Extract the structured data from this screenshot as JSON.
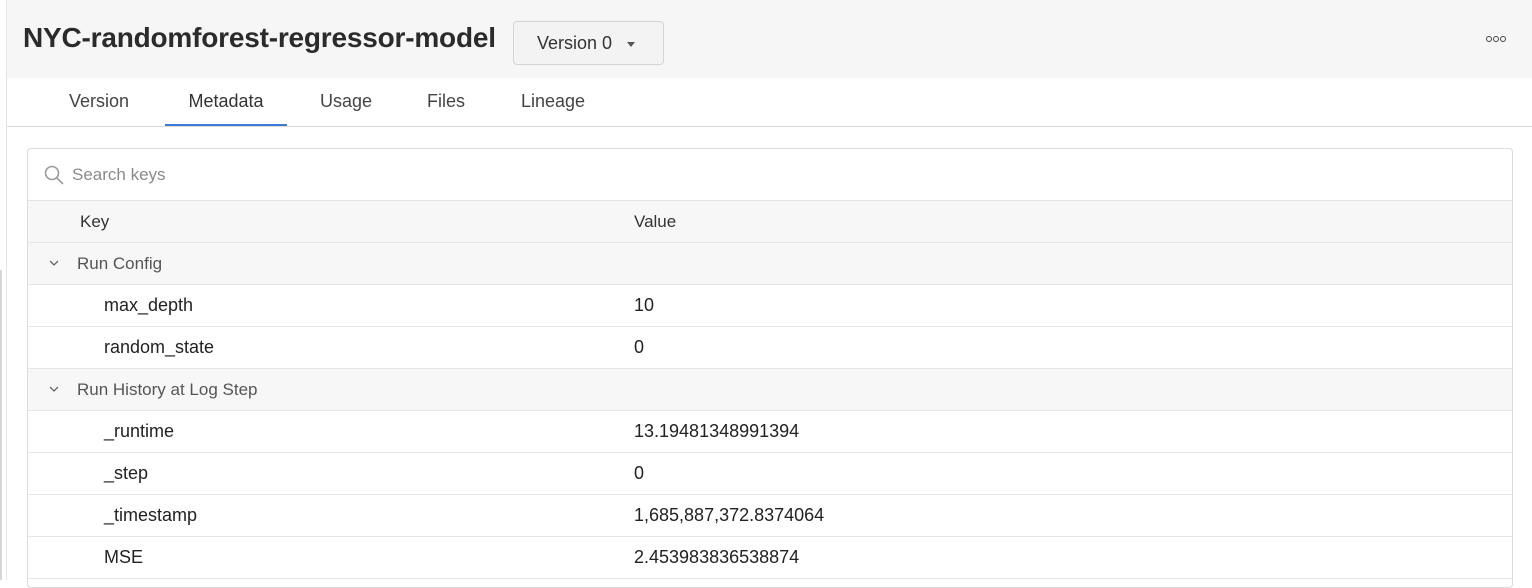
{
  "header": {
    "title": "NYC-randomforest-regressor-model",
    "version_label": "Version 0"
  },
  "tabs": [
    {
      "label": "Version",
      "active": false
    },
    {
      "label": "Metadata",
      "active": true
    },
    {
      "label": "Usage",
      "active": false
    },
    {
      "label": "Files",
      "active": false
    },
    {
      "label": "Lineage",
      "active": false
    }
  ],
  "search": {
    "placeholder": "Search keys",
    "value": ""
  },
  "table": {
    "columns": [
      "Key",
      "Value"
    ],
    "groups": [
      {
        "name": "Run Config",
        "expanded": true,
        "rows": [
          {
            "key": "max_depth",
            "value": "10"
          },
          {
            "key": "random_state",
            "value": "0"
          }
        ]
      },
      {
        "name": "Run History at Log Step",
        "expanded": true,
        "rows": [
          {
            "key": "_runtime",
            "value": "13.19481348991394"
          },
          {
            "key": "_step",
            "value": "0"
          },
          {
            "key": "_timestamp",
            "value": "1,685,887,372.8374064"
          },
          {
            "key": "MSE",
            "value": "2.453983836538874"
          }
        ]
      }
    ]
  },
  "colors": {
    "accent": "#3a7bd5",
    "header_bg": "#f6f6f6"
  }
}
